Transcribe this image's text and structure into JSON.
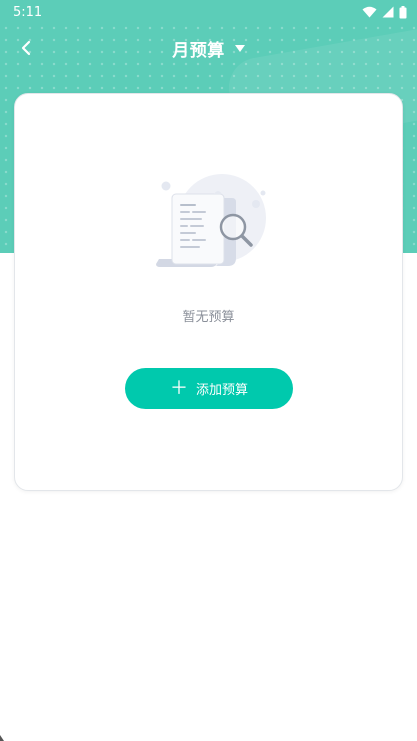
{
  "status_bar": {
    "time": "5:11"
  },
  "nav": {
    "title": "月预算"
  },
  "empty_state": {
    "message": "暂无预算"
  },
  "actions": {
    "add_budget_plus": "＋",
    "add_budget_label": "添加预算"
  },
  "colors": {
    "header_teal": "#5ccdb8",
    "button_teal": "#00c9ad",
    "muted_text": "#8a8f99"
  }
}
